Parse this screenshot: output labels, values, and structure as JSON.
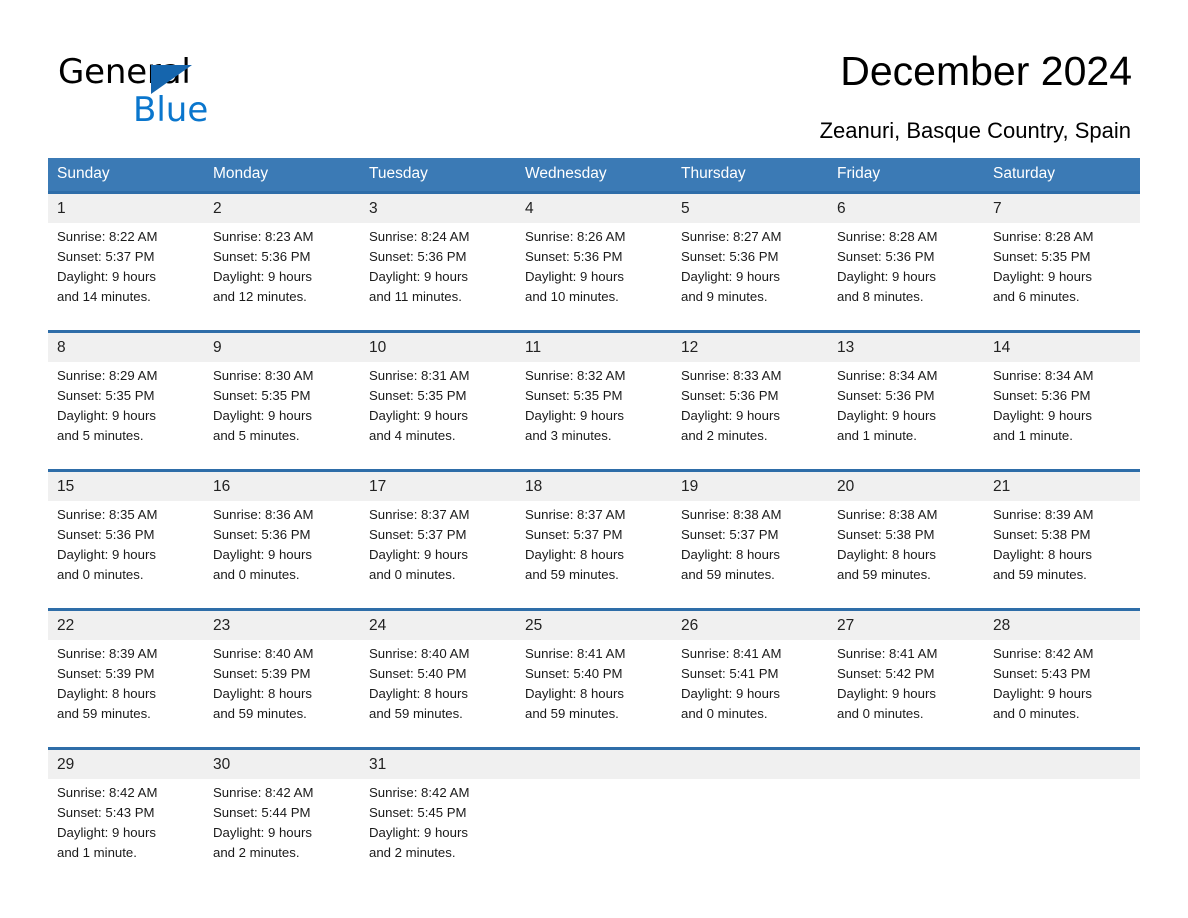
{
  "brand": {
    "name_part1": "General",
    "name_part2": "Blue",
    "triangle_icon": "triangle-icon",
    "accent_color": "#0a76cd",
    "header_color": "#3b7ab5",
    "row_border_color": "#2e6da8",
    "daynum_bg": "#f0f0f0"
  },
  "header": {
    "title": "December 2024",
    "subtitle": "Zeanuri, Basque Country, Spain"
  },
  "calendar": {
    "weekday_headers": [
      "Sunday",
      "Monday",
      "Tuesday",
      "Wednesday",
      "Thursday",
      "Friday",
      "Saturday"
    ],
    "labels": {
      "sunrise": "Sunrise:",
      "sunset": "Sunset:",
      "daylight": "Daylight:"
    },
    "weeks": [
      [
        {
          "day": "1",
          "sunrise": "Sunrise: 8:22 AM",
          "sunset": "Sunset: 5:37 PM",
          "daylight_line1": "Daylight: 9 hours",
          "daylight_line2": "and 14 minutes."
        },
        {
          "day": "2",
          "sunrise": "Sunrise: 8:23 AM",
          "sunset": "Sunset: 5:36 PM",
          "daylight_line1": "Daylight: 9 hours",
          "daylight_line2": "and 12 minutes."
        },
        {
          "day": "3",
          "sunrise": "Sunrise: 8:24 AM",
          "sunset": "Sunset: 5:36 PM",
          "daylight_line1": "Daylight: 9 hours",
          "daylight_line2": "and 11 minutes."
        },
        {
          "day": "4",
          "sunrise": "Sunrise: 8:26 AM",
          "sunset": "Sunset: 5:36 PM",
          "daylight_line1": "Daylight: 9 hours",
          "daylight_line2": "and 10 minutes."
        },
        {
          "day": "5",
          "sunrise": "Sunrise: 8:27 AM",
          "sunset": "Sunset: 5:36 PM",
          "daylight_line1": "Daylight: 9 hours",
          "daylight_line2": "and 9 minutes."
        },
        {
          "day": "6",
          "sunrise": "Sunrise: 8:28 AM",
          "sunset": "Sunset: 5:36 PM",
          "daylight_line1": "Daylight: 9 hours",
          "daylight_line2": "and 8 minutes."
        },
        {
          "day": "7",
          "sunrise": "Sunrise: 8:28 AM",
          "sunset": "Sunset: 5:35 PM",
          "daylight_line1": "Daylight: 9 hours",
          "daylight_line2": "and 6 minutes."
        }
      ],
      [
        {
          "day": "8",
          "sunrise": "Sunrise: 8:29 AM",
          "sunset": "Sunset: 5:35 PM",
          "daylight_line1": "Daylight: 9 hours",
          "daylight_line2": "and 5 minutes."
        },
        {
          "day": "9",
          "sunrise": "Sunrise: 8:30 AM",
          "sunset": "Sunset: 5:35 PM",
          "daylight_line1": "Daylight: 9 hours",
          "daylight_line2": "and 5 minutes."
        },
        {
          "day": "10",
          "sunrise": "Sunrise: 8:31 AM",
          "sunset": "Sunset: 5:35 PM",
          "daylight_line1": "Daylight: 9 hours",
          "daylight_line2": "and 4 minutes."
        },
        {
          "day": "11",
          "sunrise": "Sunrise: 8:32 AM",
          "sunset": "Sunset: 5:35 PM",
          "daylight_line1": "Daylight: 9 hours",
          "daylight_line2": "and 3 minutes."
        },
        {
          "day": "12",
          "sunrise": "Sunrise: 8:33 AM",
          "sunset": "Sunset: 5:36 PM",
          "daylight_line1": "Daylight: 9 hours",
          "daylight_line2": "and 2 minutes."
        },
        {
          "day": "13",
          "sunrise": "Sunrise: 8:34 AM",
          "sunset": "Sunset: 5:36 PM",
          "daylight_line1": "Daylight: 9 hours",
          "daylight_line2": "and 1 minute."
        },
        {
          "day": "14",
          "sunrise": "Sunrise: 8:34 AM",
          "sunset": "Sunset: 5:36 PM",
          "daylight_line1": "Daylight: 9 hours",
          "daylight_line2": "and 1 minute."
        }
      ],
      [
        {
          "day": "15",
          "sunrise": "Sunrise: 8:35 AM",
          "sunset": "Sunset: 5:36 PM",
          "daylight_line1": "Daylight: 9 hours",
          "daylight_line2": "and 0 minutes."
        },
        {
          "day": "16",
          "sunrise": "Sunrise: 8:36 AM",
          "sunset": "Sunset: 5:36 PM",
          "daylight_line1": "Daylight: 9 hours",
          "daylight_line2": "and 0 minutes."
        },
        {
          "day": "17",
          "sunrise": "Sunrise: 8:37 AM",
          "sunset": "Sunset: 5:37 PM",
          "daylight_line1": "Daylight: 9 hours",
          "daylight_line2": "and 0 minutes."
        },
        {
          "day": "18",
          "sunrise": "Sunrise: 8:37 AM",
          "sunset": "Sunset: 5:37 PM",
          "daylight_line1": "Daylight: 8 hours",
          "daylight_line2": "and 59 minutes."
        },
        {
          "day": "19",
          "sunrise": "Sunrise: 8:38 AM",
          "sunset": "Sunset: 5:37 PM",
          "daylight_line1": "Daylight: 8 hours",
          "daylight_line2": "and 59 minutes."
        },
        {
          "day": "20",
          "sunrise": "Sunrise: 8:38 AM",
          "sunset": "Sunset: 5:38 PM",
          "daylight_line1": "Daylight: 8 hours",
          "daylight_line2": "and 59 minutes."
        },
        {
          "day": "21",
          "sunrise": "Sunrise: 8:39 AM",
          "sunset": "Sunset: 5:38 PM",
          "daylight_line1": "Daylight: 8 hours",
          "daylight_line2": "and 59 minutes."
        }
      ],
      [
        {
          "day": "22",
          "sunrise": "Sunrise: 8:39 AM",
          "sunset": "Sunset: 5:39 PM",
          "daylight_line1": "Daylight: 8 hours",
          "daylight_line2": "and 59 minutes."
        },
        {
          "day": "23",
          "sunrise": "Sunrise: 8:40 AM",
          "sunset": "Sunset: 5:39 PM",
          "daylight_line1": "Daylight: 8 hours",
          "daylight_line2": "and 59 minutes."
        },
        {
          "day": "24",
          "sunrise": "Sunrise: 8:40 AM",
          "sunset": "Sunset: 5:40 PM",
          "daylight_line1": "Daylight: 8 hours",
          "daylight_line2": "and 59 minutes."
        },
        {
          "day": "25",
          "sunrise": "Sunrise: 8:41 AM",
          "sunset": "Sunset: 5:40 PM",
          "daylight_line1": "Daylight: 8 hours",
          "daylight_line2": "and 59 minutes."
        },
        {
          "day": "26",
          "sunrise": "Sunrise: 8:41 AM",
          "sunset": "Sunset: 5:41 PM",
          "daylight_line1": "Daylight: 9 hours",
          "daylight_line2": "and 0 minutes."
        },
        {
          "day": "27",
          "sunrise": "Sunrise: 8:41 AM",
          "sunset": "Sunset: 5:42 PM",
          "daylight_line1": "Daylight: 9 hours",
          "daylight_line2": "and 0 minutes."
        },
        {
          "day": "28",
          "sunrise": "Sunrise: 8:42 AM",
          "sunset": "Sunset: 5:43 PM",
          "daylight_line1": "Daylight: 9 hours",
          "daylight_line2": "and 0 minutes."
        }
      ],
      [
        {
          "day": "29",
          "sunrise": "Sunrise: 8:42 AM",
          "sunset": "Sunset: 5:43 PM",
          "daylight_line1": "Daylight: 9 hours",
          "daylight_line2": "and 1 minute."
        },
        {
          "day": "30",
          "sunrise": "Sunrise: 8:42 AM",
          "sunset": "Sunset: 5:44 PM",
          "daylight_line1": "Daylight: 9 hours",
          "daylight_line2": "and 2 minutes."
        },
        {
          "day": "31",
          "sunrise": "Sunrise: 8:42 AM",
          "sunset": "Sunset: 5:45 PM",
          "daylight_line1": "Daylight: 9 hours",
          "daylight_line2": "and 2 minutes."
        },
        {
          "day": "",
          "sunrise": "",
          "sunset": "",
          "daylight_line1": "",
          "daylight_line2": ""
        },
        {
          "day": "",
          "sunrise": "",
          "sunset": "",
          "daylight_line1": "",
          "daylight_line2": ""
        },
        {
          "day": "",
          "sunrise": "",
          "sunset": "",
          "daylight_line1": "",
          "daylight_line2": ""
        },
        {
          "day": "",
          "sunrise": "",
          "sunset": "",
          "daylight_line1": "",
          "daylight_line2": ""
        }
      ]
    ]
  }
}
